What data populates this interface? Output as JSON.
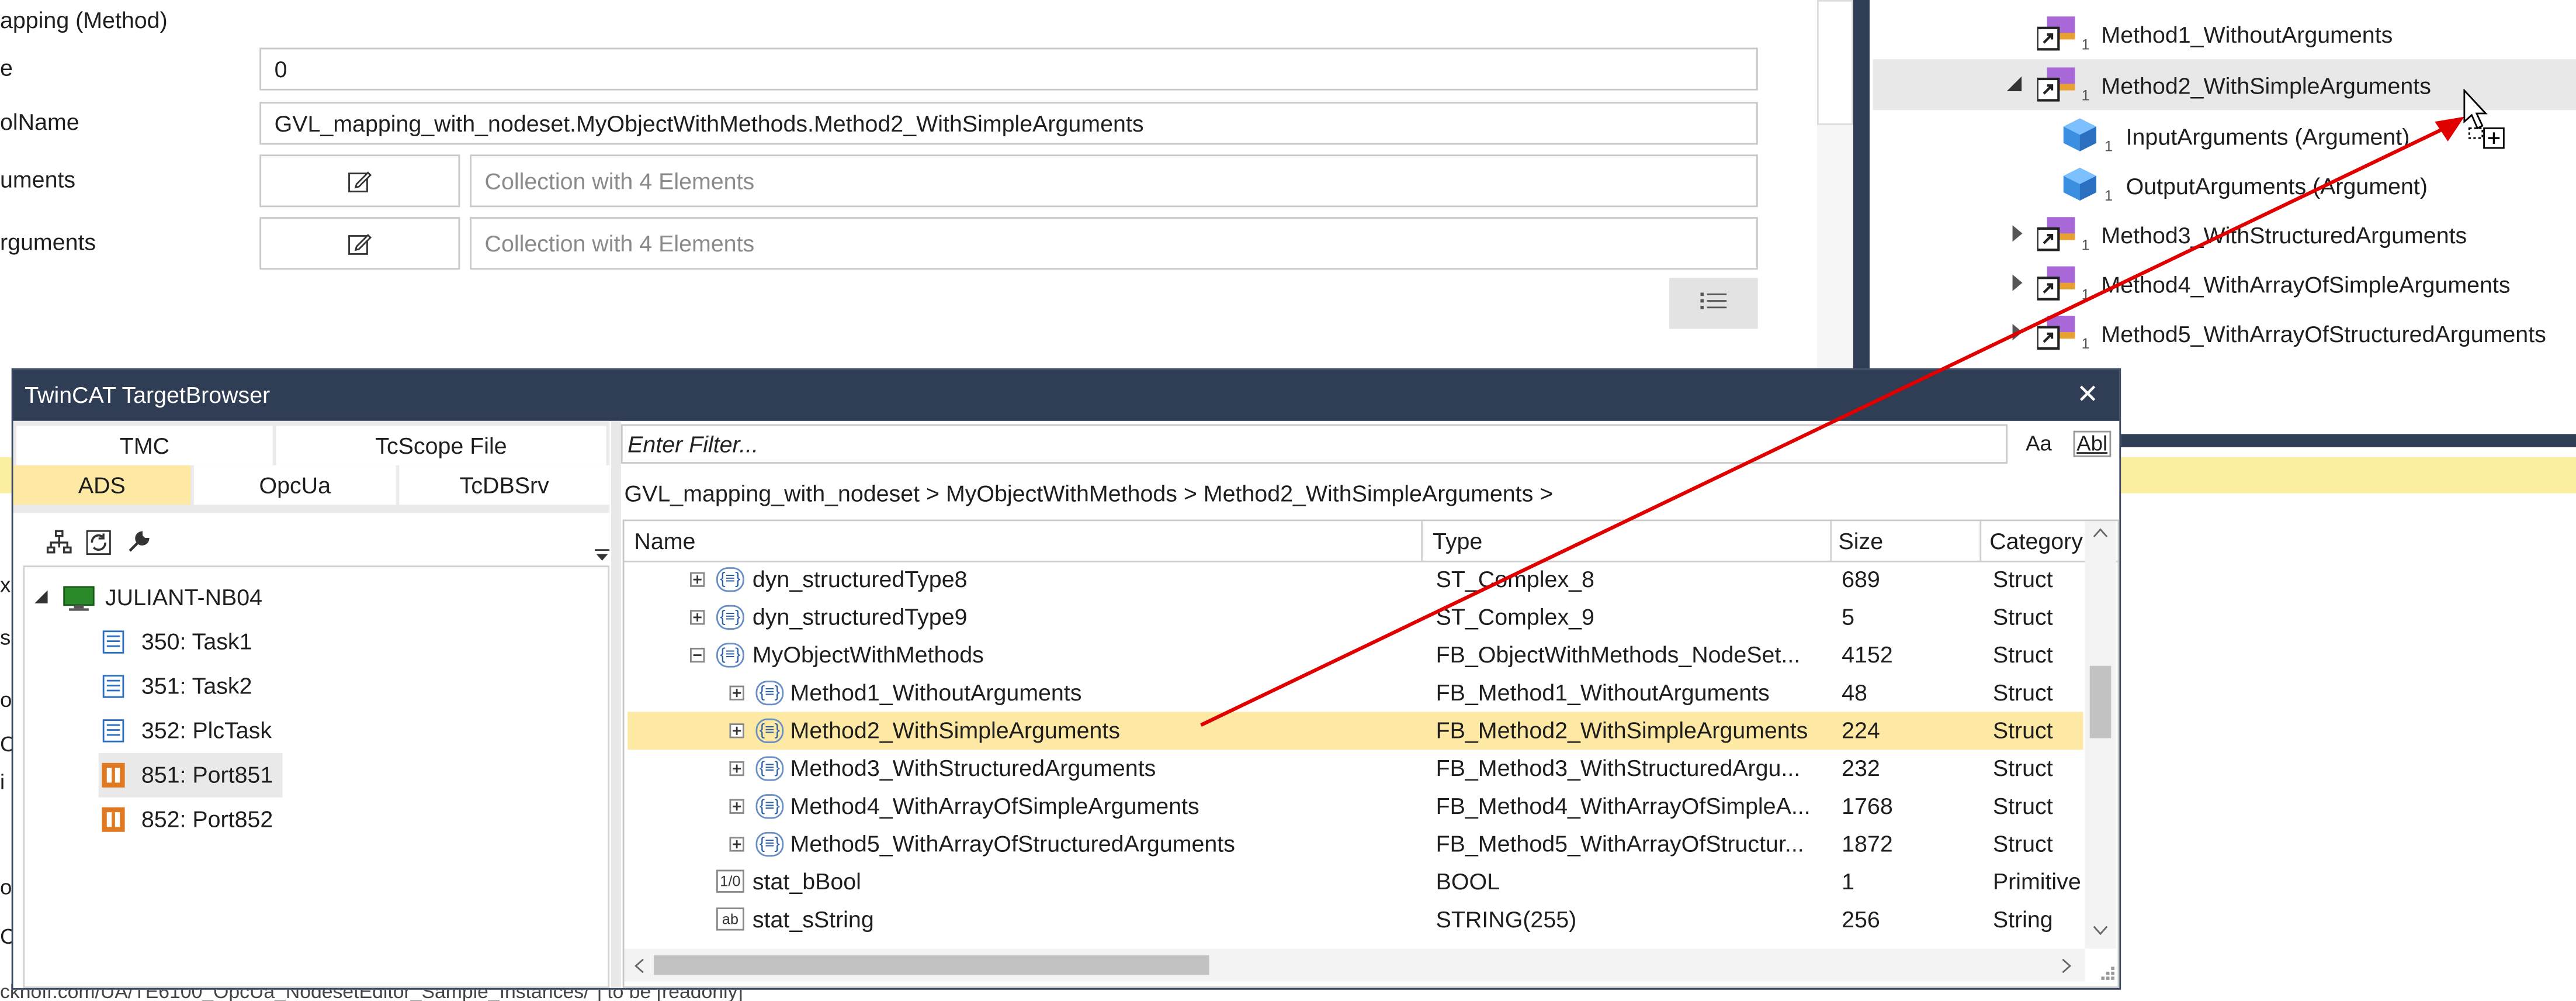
{
  "properties": {
    "section_title": "apping (Method)",
    "rows": [
      {
        "label": "e",
        "value": "0"
      },
      {
        "label": "olName",
        "value": "GVL_mapping_with_nodeset.MyObjectWithMethods.Method2_WithSimpleArguments"
      },
      {
        "label": "uments",
        "value": "Collection with 4 Elements"
      },
      {
        "label": "rguments",
        "value": "Collection with 4 Elements"
      }
    ]
  },
  "right_tree": {
    "items": [
      {
        "label": "Method1_WithoutArguments",
        "badge": "1"
      },
      {
        "label": "Method2_WithSimpleArguments",
        "badge": "1"
      },
      {
        "label": "InputArguments (Argument)",
        "badge": "1"
      },
      {
        "label": "OutputArguments (Argument)",
        "badge": "1"
      },
      {
        "label": "Method3_WithStructuredArguments",
        "badge": "1"
      },
      {
        "label": "Method4_WithArrayOfSimpleArguments",
        "badge": "1"
      },
      {
        "label": "Method5_WithArrayOfStructuredArguments",
        "badge": "1"
      }
    ]
  },
  "left_fragments": [
    "x",
    "s",
    "o",
    "C",
    "i",
    "o",
    "C"
  ],
  "bottom_fragment": "ckhoff.com/UA/TE6100_OpcUa_NodesetEditor_Sample_Instances/\"] to be [readonly]",
  "dialog": {
    "title": "TwinCAT TargetBrowser",
    "close_glyph": "✕",
    "tabs_top": [
      "TMC",
      "TcScope File"
    ],
    "tabs_bottom": [
      "ADS",
      "OpcUa",
      "TcDBSrv"
    ],
    "filter_placeholder": "Enter Filter...",
    "match_case_label": "Aa",
    "match_word_label": "Abl",
    "breadcrumb": "GVL_mapping_with_nodeset > MyObjectWithMethods > Method2_WithSimpleArguments >",
    "tree": {
      "root": "JULIANT-NB04",
      "children": [
        "350: Task1",
        "351: Task2",
        "352: PlcTask",
        "851: Port851",
        "852: Port852"
      ]
    },
    "columns": [
      "Name",
      "Type",
      "Size",
      "Category"
    ],
    "rows": [
      {
        "name": "dyn_structuredType8",
        "type": "ST_Complex_8",
        "size": "689",
        "category": "Struct",
        "icon": "{≡}"
      },
      {
        "name": "dyn_structuredType9",
        "type": "ST_Complex_9",
        "size": "5",
        "category": "Struct",
        "icon": "{≡}"
      },
      {
        "name": "MyObjectWithMethods",
        "type": "FB_ObjectWithMethods_NodeSet...",
        "size": "4152",
        "category": "Struct",
        "icon": "{≡}"
      },
      {
        "name": "Method1_WithoutArguments",
        "type": "FB_Method1_WithoutArguments",
        "size": "48",
        "category": "Struct",
        "icon": "{≡}"
      },
      {
        "name": "Method2_WithSimpleArguments",
        "type": "FB_Method2_WithSimpleArguments",
        "size": "224",
        "category": "Struct",
        "icon": "{≡}"
      },
      {
        "name": "Method3_WithStructuredArguments",
        "type": "FB_Method3_WithStructuredArgu...",
        "size": "232",
        "category": "Struct",
        "icon": "{≡}"
      },
      {
        "name": "Method4_WithArrayOfSimpleArguments",
        "type": "FB_Method4_WithArrayOfSimpleA...",
        "size": "1768",
        "category": "Struct",
        "icon": "{≡}"
      },
      {
        "name": "Method5_WithArrayOfStructuredArguments",
        "type": "FB_Method5_WithArrayOfStructur...",
        "size": "1872",
        "category": "Struct",
        "icon": "{≡}"
      },
      {
        "name": "stat_bBool",
        "type": "BOOL",
        "size": "1",
        "category": "Primitive",
        "icon": "1/0"
      },
      {
        "name": "stat_sString",
        "type": "STRING(255)",
        "size": "256",
        "category": "String",
        "icon": "ab"
      }
    ]
  },
  "colors": {
    "dialog_title_bg": "#2f3d55",
    "selected_row": "#fde9a4",
    "selected_tab": "#fde9a4",
    "drag_arrow": "#e00000",
    "tree_header_highlight": "#fbeea0"
  }
}
